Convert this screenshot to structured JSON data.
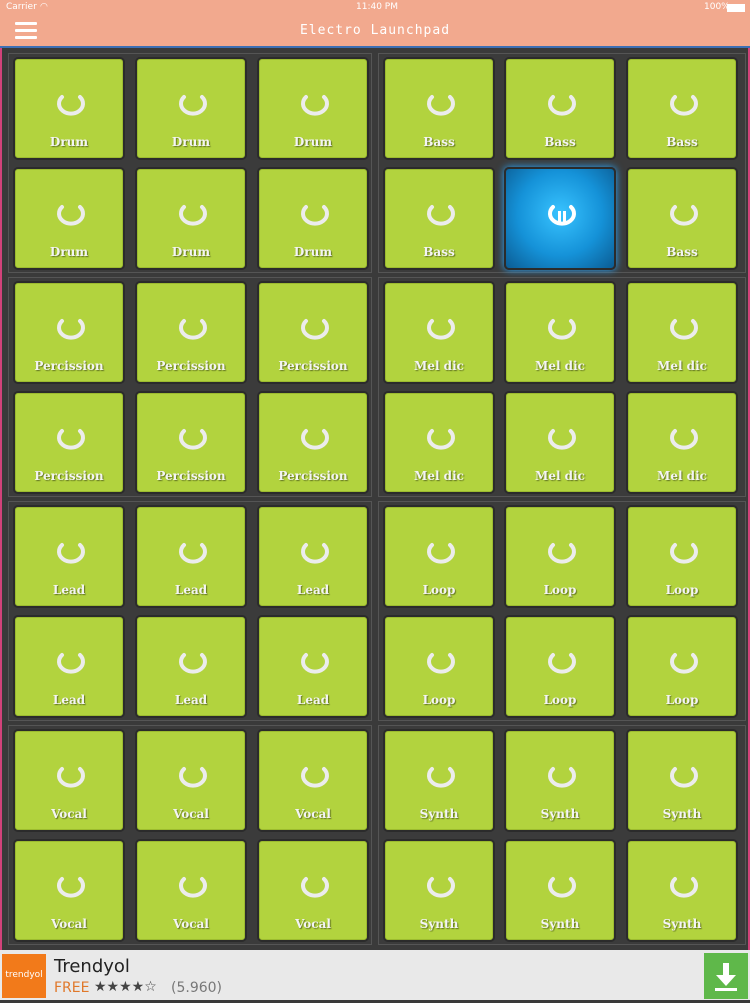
{
  "status_bar": {
    "carrier": "Carrier",
    "time": "11:40 PM",
    "battery": "100%"
  },
  "nav": {
    "title": "Electro Launchpad",
    "menu_icon": "hamburger-menu-icon"
  },
  "pads": {
    "labels": [
      [
        "Drum",
        "Drum",
        "Drum",
        "Bass",
        "Bass",
        "Bass"
      ],
      [
        "Drum",
        "Drum",
        "Drum",
        "Bass",
        "",
        "Bass"
      ],
      [
        "Percission",
        "Percission",
        "Percission",
        "Mel dic",
        "Mel dic",
        "Mel dic"
      ],
      [
        "Percission",
        "Percission",
        "Percission",
        "Mel dic",
        "Mel dic",
        "Mel dic"
      ],
      [
        "Lead",
        "Lead",
        "Lead",
        "Loop",
        "Loop",
        "Loop"
      ],
      [
        "Lead",
        "Lead",
        "Lead",
        "Loop",
        "Loop",
        "Loop"
      ],
      [
        "Vocal",
        "Vocal",
        "Vocal",
        "Synth",
        "Synth",
        "Synth"
      ],
      [
        "Vocal",
        "Vocal",
        "Vocal",
        "Synth",
        "Synth",
        "Synth"
      ]
    ],
    "active": {
      "row": 1,
      "col": 4,
      "icon": "pause-icon"
    },
    "pad_icon": "loop-ring-icon",
    "colors": {
      "pad": "#b2d33e",
      "active": "#1592d8",
      "background": "#3a3a3a",
      "navbar": "#f2a98e"
    }
  },
  "ad": {
    "brand": "Trendyol",
    "logo_text": "trendyol",
    "price": "FREE",
    "stars": "★★★★☆",
    "rating_count": "(5.960)",
    "download_icon": "download-icon"
  }
}
